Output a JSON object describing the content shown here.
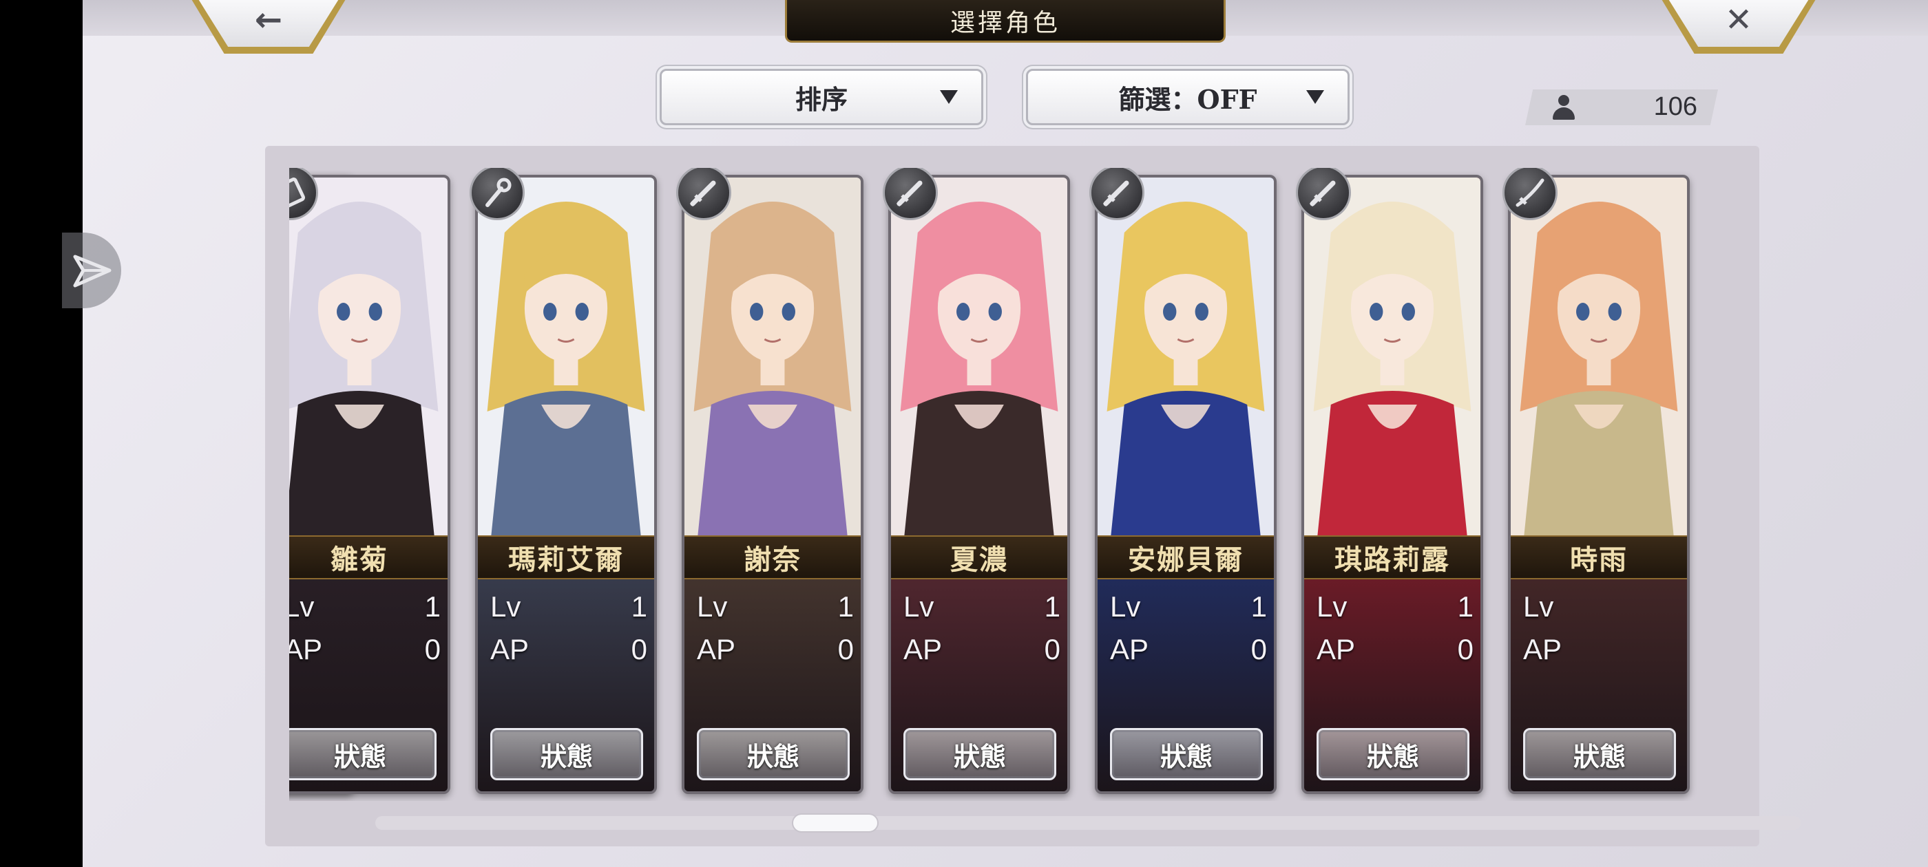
{
  "header": {
    "title": "選擇角色",
    "back_icon": "←",
    "close_icon": "✕"
  },
  "controls": {
    "sort_label": "排序",
    "filter_label": "篩選：OFF",
    "character_count": "106"
  },
  "cards": [
    {
      "name": "",
      "weapon": "partial-card",
      "lv_label": "Lv",
      "lv": "1",
      "ap_label": "AP",
      "ap": "0",
      "status_label": "狀態"
    },
    {
      "name": "雛菊",
      "weapon": "book",
      "lv_label": "Lv",
      "lv": "1",
      "ap_label": "AP",
      "ap": "0",
      "status_label": "狀態"
    },
    {
      "name": "瑪莉艾爾",
      "weapon": "staff",
      "lv_label": "Lv",
      "lv": "1",
      "ap_label": "AP",
      "ap": "0",
      "status_label": "狀態"
    },
    {
      "name": "謝奈",
      "weapon": "sword",
      "lv_label": "Lv",
      "lv": "1",
      "ap_label": "AP",
      "ap": "0",
      "status_label": "狀態"
    },
    {
      "name": "夏濃",
      "weapon": "sword",
      "lv_label": "Lv",
      "lv": "1",
      "ap_label": "AP",
      "ap": "0",
      "status_label": "狀態"
    },
    {
      "name": "安娜貝爾",
      "weapon": "sword",
      "lv_label": "Lv",
      "lv": "1",
      "ap_label": "AP",
      "ap": "0",
      "status_label": "狀態"
    },
    {
      "name": "琪路莉露",
      "weapon": "sword",
      "lv_label": "Lv",
      "lv": "1",
      "ap_label": "AP",
      "ap": "0",
      "status_label": "狀態"
    },
    {
      "name": "時雨",
      "weapon": "katana",
      "lv_label": "Lv",
      "lv": "",
      "ap_label": "AP",
      "ap": "",
      "status_label": "狀態"
    }
  ],
  "scroll": {
    "position_fraction": 0.3
  },
  "colors": {
    "accent_gold": "#b89a45",
    "name_band": "#2b1e10",
    "name_text": "#f0dfb0"
  }
}
